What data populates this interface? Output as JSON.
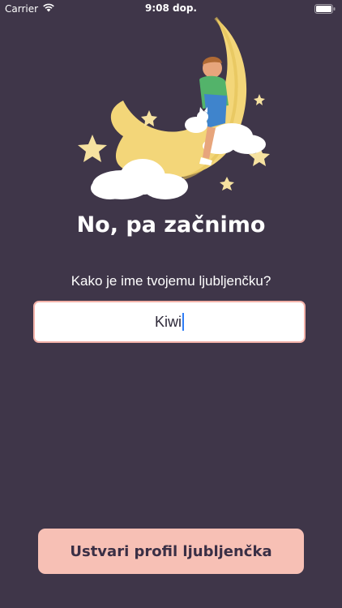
{
  "status_bar": {
    "carrier": "Carrier",
    "time": "9:08 dop.",
    "wifi_icon": "wifi-icon",
    "battery_icon": "battery-icon"
  },
  "illustration": {
    "subject": "child-sleeping-on-crescent-moon-with-cat",
    "moon_color": "#f3d679",
    "star_color": "#f6e2a0",
    "cloud_color": "#ffffff"
  },
  "onboarding": {
    "title": "No, pa začnimo",
    "question": "Kako je ime tvojemu ljubljenčku?",
    "pet_name_value": "Kiwi",
    "pet_name_placeholder": ""
  },
  "actions": {
    "create_profile_label": "Ustvari profil ljubljenčka"
  },
  "colors": {
    "background": "#3f3649",
    "accent": "#f7c0b5",
    "field_border": "#f3b2a9",
    "caret": "#2f7df6"
  }
}
